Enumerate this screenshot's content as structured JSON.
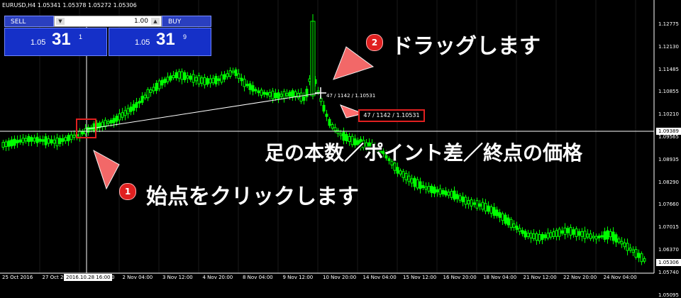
{
  "window": {
    "title": "EURUSD,H4  1.05341 1.05378 1.05272 1.05306"
  },
  "trade_panel": {
    "sell_label": "SELL",
    "buy_label": "BUY",
    "lot_value": "1.00",
    "sell_price_small": "1.05",
    "sell_price_big": "31",
    "sell_price_sup": "1",
    "buy_price_small": "1.05",
    "buy_price_big": "31",
    "buy_price_sup": "9"
  },
  "annotations": {
    "step1_number": "1",
    "step1_text": "始点をクリックします",
    "step2_number": "2",
    "step2_text": "ドラッグします",
    "info_text": "足の本数／ポイント差／終点の価格",
    "tooltip_text": "47 / 1142 / 1.10531",
    "cursor_text": "47 / 1142 / 1.10531"
  },
  "y_axis": {
    "labels": [
      "1.12775",
      "1.12130",
      "1.11485",
      "1.10855",
      "1.10210",
      "1.09565",
      "1.08935",
      "1.08290",
      "1.07660",
      "1.07015",
      "1.06370",
      "1.05740",
      "1.05095"
    ],
    "horizontal_line_label": "1.09389",
    "current_price_label": "1.05306"
  },
  "x_axis": {
    "labels": [
      "25 Oct 2016",
      "27 Oct 20",
      "31 Oct 20:00",
      "2 Nov 04:00",
      "3 Nov 12:00",
      "4 Nov 20:00",
      "8 Nov 04:00",
      "9 Nov 12:00",
      "10 Nov 20:00",
      "14 Nov 04:00",
      "15 Nov 12:00",
      "16 Nov 20:00",
      "18 Nov 04:00",
      "21 Nov 12:00",
      "22 Nov 20:00",
      "24 Nov 04:00"
    ],
    "crosshair_date": "2016.10.28 16:00"
  },
  "colors": {
    "background": "#000000",
    "candle": "#00ff00",
    "accent_red": "#e02020",
    "panel_blue": "#1530c8"
  }
}
